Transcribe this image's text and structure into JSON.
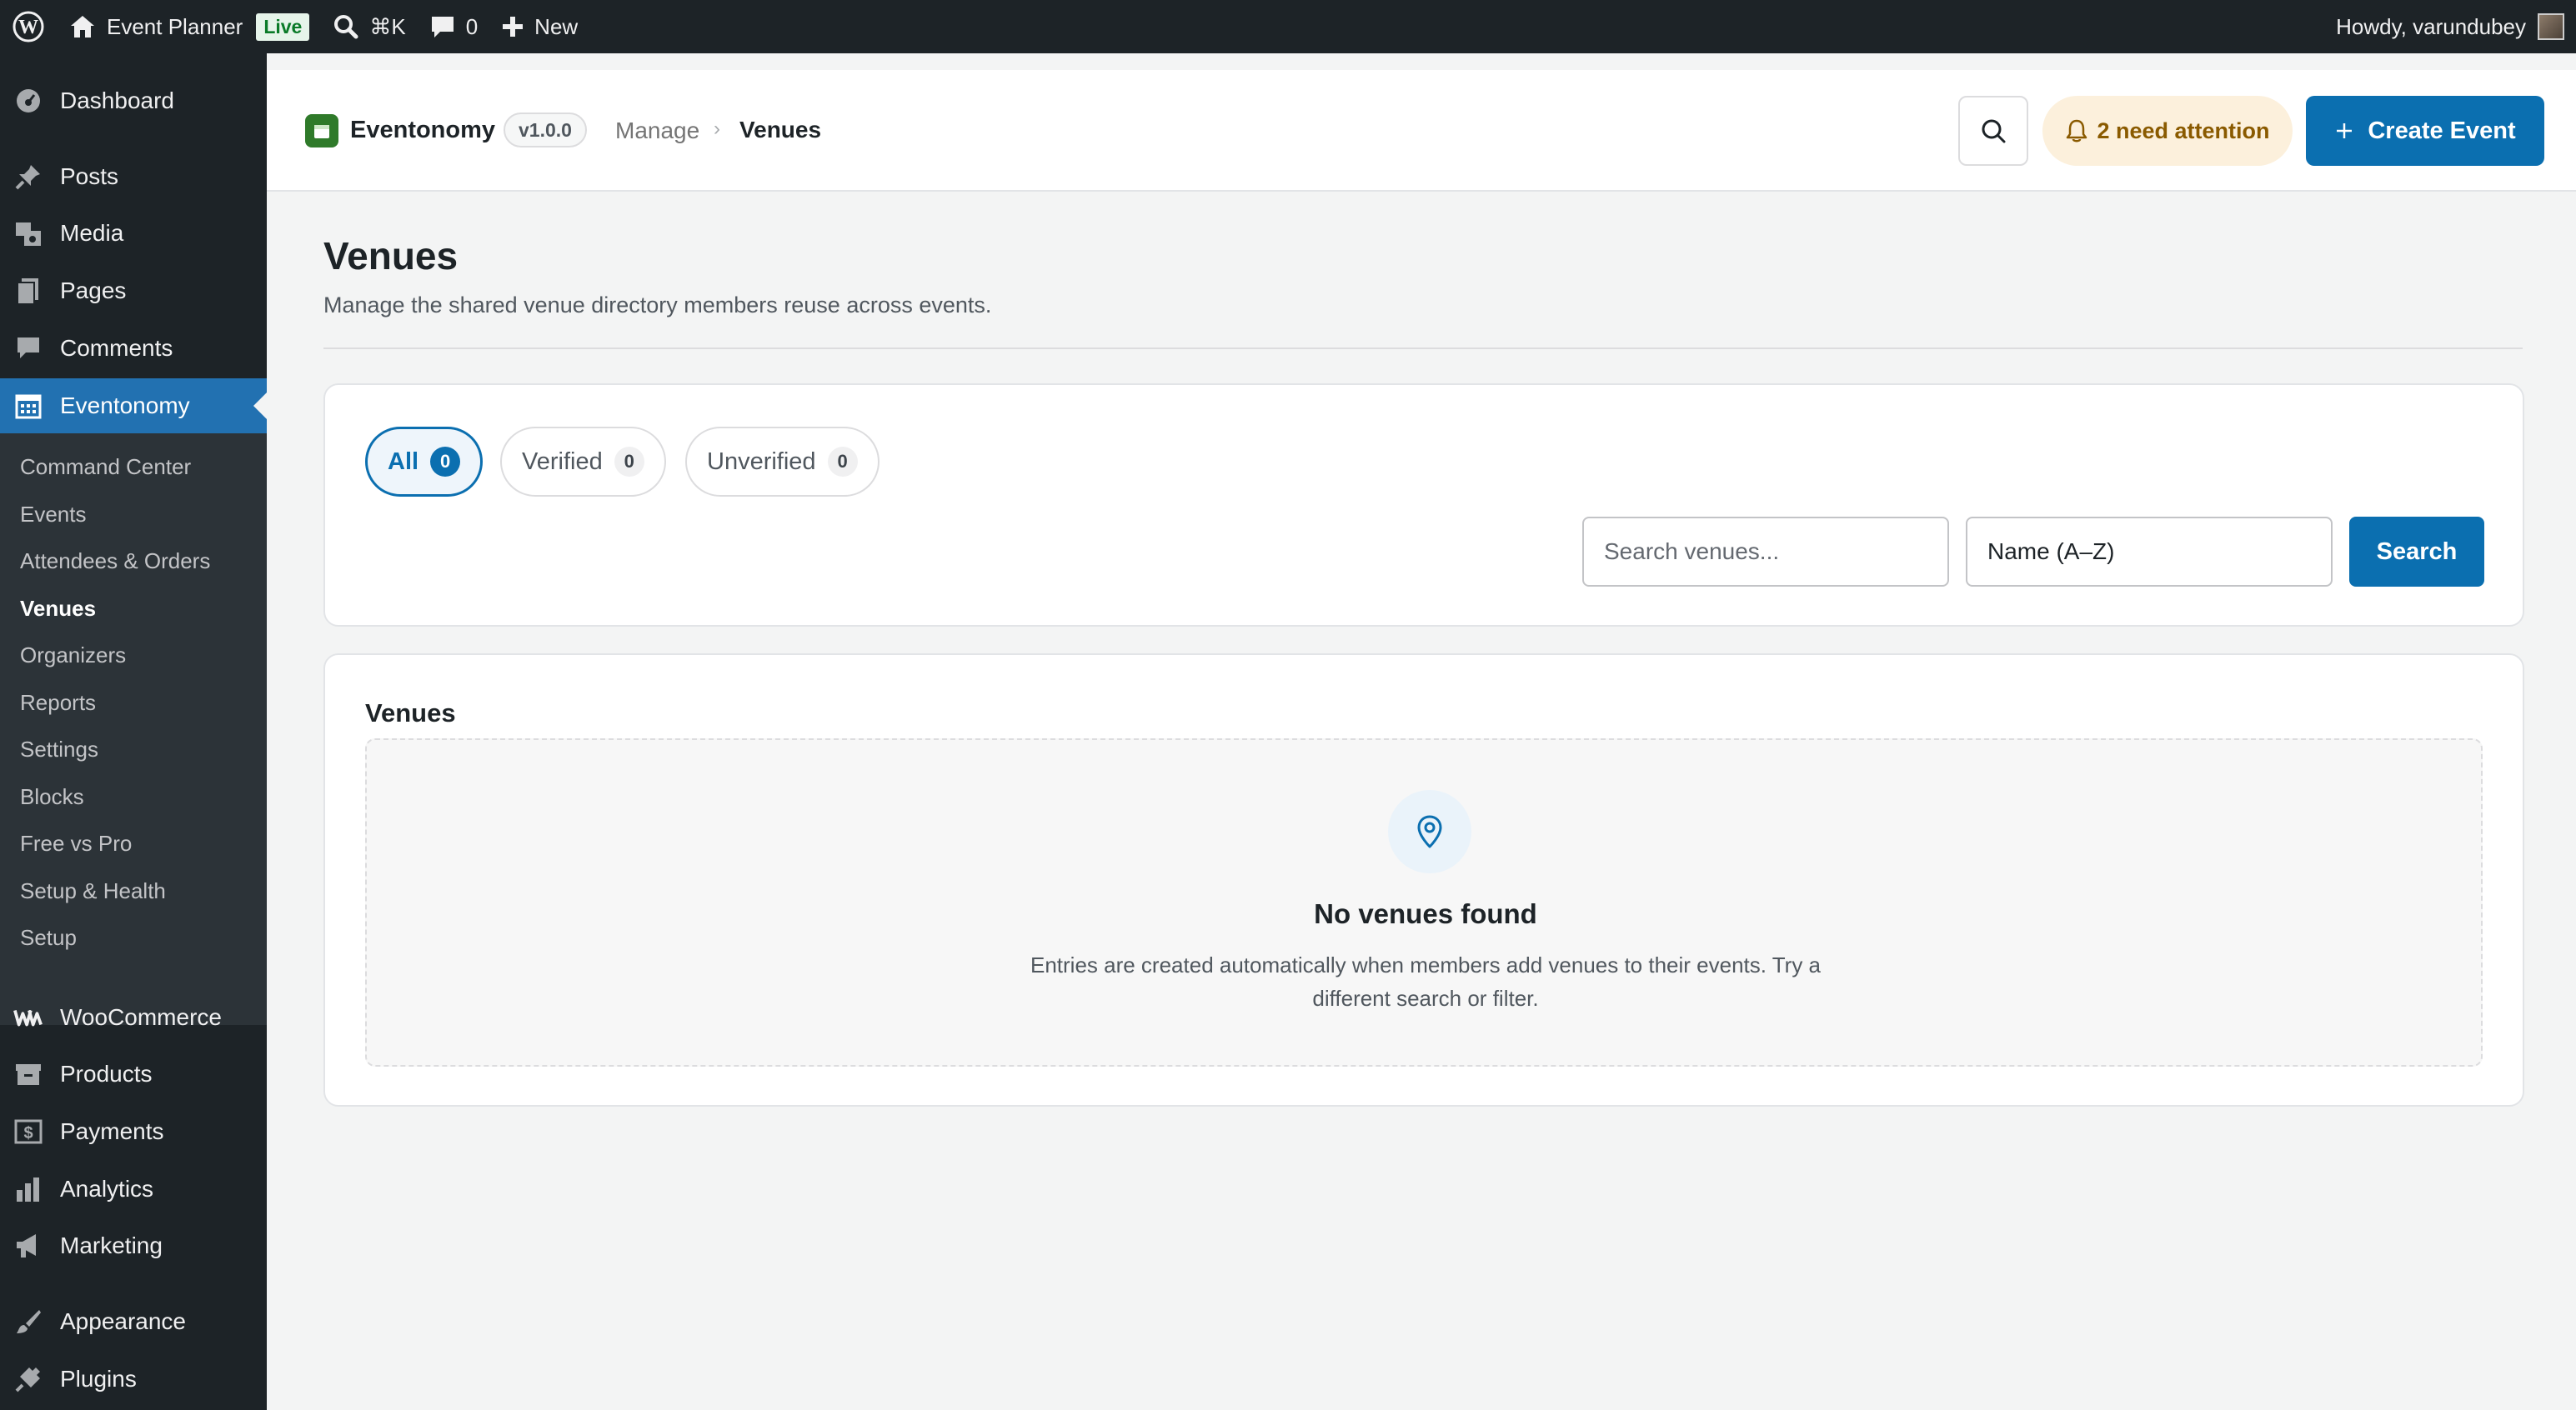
{
  "adminbar": {
    "site_name": "Event Planner",
    "live_badge": "Live",
    "shortcut": "⌘K",
    "comments_count": "0",
    "new_label": "New",
    "greeting": "Howdy, varundubey"
  },
  "sidebar": {
    "items": [
      {
        "label": "Dashboard",
        "icon": "dashboard-icon"
      },
      {
        "label": "Posts",
        "icon": "pin-icon"
      },
      {
        "label": "Media",
        "icon": "media-icon"
      },
      {
        "label": "Pages",
        "icon": "pages-icon"
      },
      {
        "label": "Comments",
        "icon": "comment-icon"
      },
      {
        "label": "Eventonomy",
        "icon": "calendar-icon",
        "active": true
      },
      {
        "label": "WooCommerce",
        "icon": "woo-icon"
      },
      {
        "label": "Products",
        "icon": "archive-icon"
      },
      {
        "label": "Payments",
        "icon": "dollar-icon"
      },
      {
        "label": "Analytics",
        "icon": "bar-chart-icon"
      },
      {
        "label": "Marketing",
        "icon": "megaphone-icon"
      },
      {
        "label": "Appearance",
        "icon": "brush-icon"
      },
      {
        "label": "Plugins",
        "icon": "plug-icon"
      }
    ],
    "submenu": [
      "Command Center",
      "Events",
      "Attendees & Orders",
      "Venues",
      "Organizers",
      "Reports",
      "Settings",
      "Blocks",
      "Free vs Pro",
      "Setup & Health",
      "Setup"
    ],
    "current_submenu": "Venues"
  },
  "header": {
    "brand": "Eventonomy",
    "version": "v1.0.0",
    "breadcrumb_parent": "Manage",
    "breadcrumb_sep": "›",
    "breadcrumb_current": "Venues",
    "attention_label": "2 need attention",
    "create_label": "Create Event"
  },
  "page": {
    "title": "Venues",
    "subtitle": "Manage the shared venue directory members reuse across events."
  },
  "filters": {
    "tabs": [
      {
        "label": "All",
        "count": "0",
        "active": true
      },
      {
        "label": "Verified",
        "count": "0"
      },
      {
        "label": "Unverified",
        "count": "0"
      }
    ],
    "search_placeholder": "Search venues...",
    "sort_value": "Name (A–Z)",
    "search_button": "Search"
  },
  "list": {
    "title": "Venues",
    "empty_title": "No venues found",
    "empty_desc": "Entries are created automatically when members add venues to their events. Try a different search or filter."
  },
  "colors": {
    "accent": "#0b6fb0",
    "wp_active": "#2271b1",
    "admin_dark": "#1d2327",
    "attention_bg": "#fcf0dc",
    "attention_text": "#8a5a00",
    "live_green": "#0a7a28"
  }
}
